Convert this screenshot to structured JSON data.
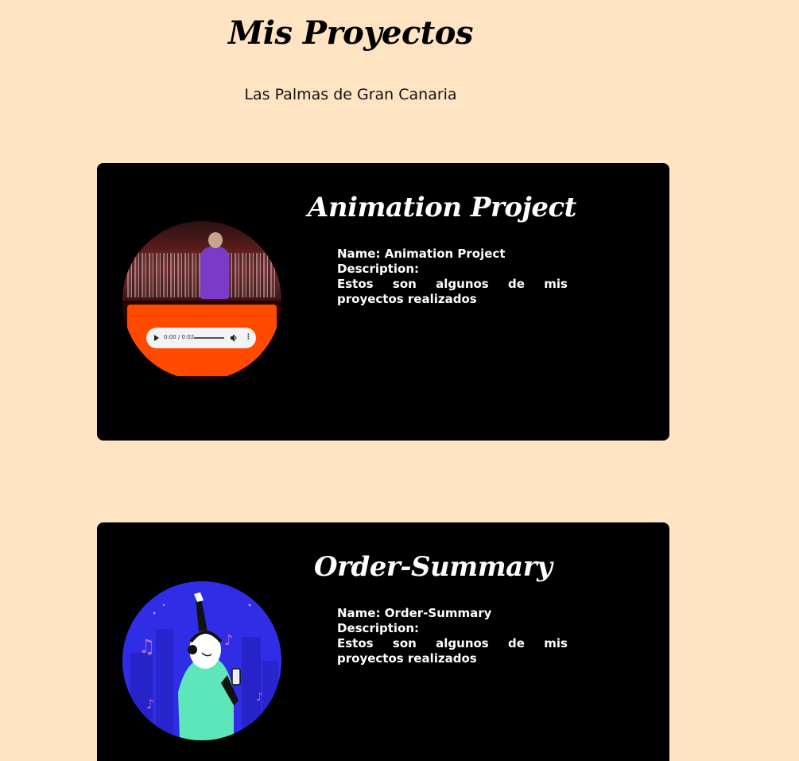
{
  "header": {
    "title": "Mis Proyectos",
    "subtitle": "Las Palmas de Gran Canaria"
  },
  "projects": [
    {
      "title": "Animation Project",
      "name_label": "Name:",
      "name_value": "Animation Project",
      "description_label": "Description:",
      "description": "Estos son algunos de mis proyectos realizados",
      "media": {
        "type": "video-with-audio",
        "audio_time": "0:00 / 0:02",
        "progress": 0,
        "icons": [
          "play-icon",
          "volume-icon",
          "more-options-icon"
        ],
        "colors": {
          "panel": "#ff4a00",
          "player": "#f1f3f4",
          "jersey": "#7a3cc8"
        }
      }
    },
    {
      "title": "Order-Summary",
      "name_label": "Name:",
      "name_value": "Order-Summary",
      "description_label": "Description:",
      "description": "Estos son algunos de mis proyectos realizados",
      "media": {
        "type": "illustration",
        "icons": [
          "music-note-icon"
        ],
        "colors": {
          "background": "#2f2de6",
          "accent": "#5de6b9"
        }
      }
    }
  ],
  "theme": {
    "page_background": "#ffe4c4",
    "card_background": "#000000",
    "card_text": "#ffffff"
  }
}
